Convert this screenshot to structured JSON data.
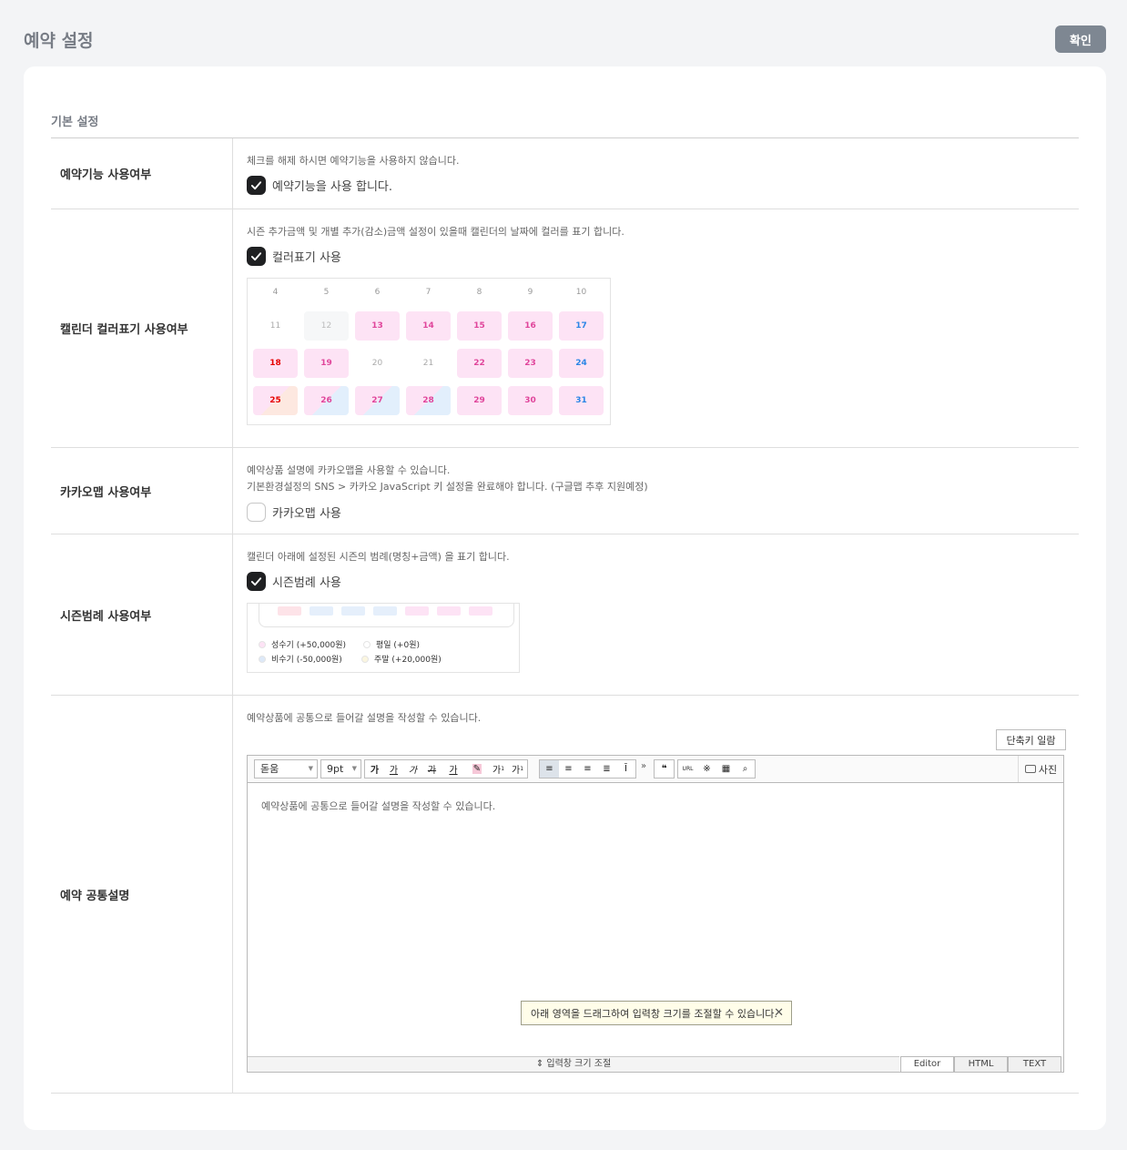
{
  "header": {
    "title": "예약 설정",
    "confirm_label": "확인"
  },
  "section": {
    "title": "기본 설정"
  },
  "rows": {
    "booking": {
      "label": "예약기능 사용여부",
      "desc": "체크를 해제 하시면 예약기능을 사용하지 않습니다.",
      "check_label": "예약기능을 사용 합니다.",
      "checked": true
    },
    "calendar_color": {
      "label": "캘린더 컬러표기 사용여부",
      "desc": "시즌 추가금액 및 개별 추가(감소)금액 설정이 있을때 캘린더의 날짜에 컬러를 표기 합니다.",
      "check_label": "컬러표기 사용",
      "checked": true
    },
    "kakao_map": {
      "label": "카카오맵 사용여부",
      "desc1": "예약상품 설명에 카카오맵을 사용할 수 있습니다.",
      "desc2": "기본환경설정의 SNS > 카카오 JavaScript 키 설정을 완료해야 합니다. (구글맵 추후 지원예정)",
      "check_label": "카카오맵 사용",
      "checked": false
    },
    "season_legend": {
      "label": "시즌범례 사용여부",
      "desc": "캘린더 아래에 설정된 시즌의 범례(명칭+금액) 을 표기 합니다.",
      "check_label": "시즌범례 사용",
      "checked": true
    },
    "common_desc": {
      "label": "예약 공통설명",
      "desc": "예약상품에 공통으로 들어갈 설명을 작성할 수 있습니다."
    }
  },
  "calendar": {
    "weeks": [
      [
        {
          "day": "4",
          "style": "header"
        },
        {
          "day": "5",
          "style": "header"
        },
        {
          "day": "6",
          "style": "header"
        },
        {
          "day": "7",
          "style": "header"
        },
        {
          "day": "8",
          "style": "header"
        },
        {
          "day": "9",
          "style": "header"
        },
        {
          "day": "10",
          "style": "header"
        }
      ],
      [
        {
          "day": "11",
          "style": "plain"
        },
        {
          "day": "12",
          "style": "gray"
        },
        {
          "day": "13",
          "style": "pink"
        },
        {
          "day": "14",
          "style": "pink"
        },
        {
          "day": "15",
          "style": "pink"
        },
        {
          "day": "16",
          "style": "pink"
        },
        {
          "day": "17",
          "style": "pink-blue"
        }
      ],
      [
        {
          "day": "18",
          "style": "pink-red"
        },
        {
          "day": "19",
          "style": "pink"
        },
        {
          "day": "20",
          "style": "plain"
        },
        {
          "day": "21",
          "style": "plain"
        },
        {
          "day": "22",
          "style": "pink"
        },
        {
          "day": "23",
          "style": "pink"
        },
        {
          "day": "24",
          "style": "pink-blue"
        }
      ],
      [
        {
          "day": "25",
          "style": "peach-red"
        },
        {
          "day": "26",
          "style": "split"
        },
        {
          "day": "27",
          "style": "split"
        },
        {
          "day": "28",
          "style": "split"
        },
        {
          "day": "29",
          "style": "pink"
        },
        {
          "day": "30",
          "style": "pink"
        },
        {
          "day": "31",
          "style": "pink-blue"
        }
      ]
    ]
  },
  "legend": {
    "items": [
      {
        "label": "성수기 (+50,000원)",
        "color": "#fde3f5"
      },
      {
        "label": "평일 (+0원)",
        "color": "#ffffff"
      },
      {
        "label": "비수기 (-50,000원)",
        "color": "#dde9f8"
      },
      {
        "label": "주말 (+20,000원)",
        "color": "#fbf6e0"
      }
    ]
  },
  "editor": {
    "shortcut_label": "단축키 일람",
    "font_value": "돋움",
    "size_value": "9pt",
    "format_buttons": [
      "가",
      "가",
      "가",
      "가",
      "가",
      "가",
      "가",
      "가"
    ],
    "photo_label": "사진",
    "placeholder": "예약상품에 공통으로 들어갈 설명을 작성할 수 있습니다.",
    "tooltip": "아래 영역을 드래그하여 입력창 크기를 조절할 수 있습니다.",
    "resize_label": "입력창 크기 조절",
    "modes": [
      "Editor",
      "HTML",
      "TEXT"
    ]
  },
  "colors": {
    "pink": "#fde3f5",
    "pink_text": "#e0459b",
    "blue_text": "#2b86e6",
    "red_text": "#e60000",
    "accent_dark": "#1f2022"
  }
}
